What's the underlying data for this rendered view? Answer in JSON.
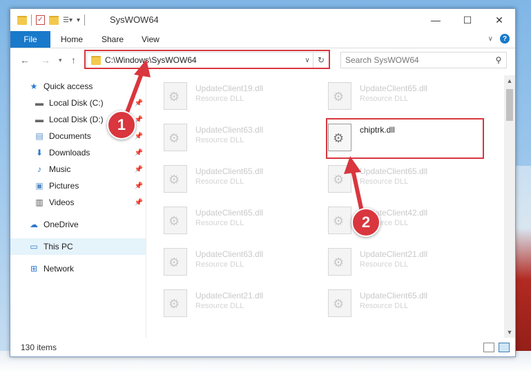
{
  "window": {
    "title": "SysWOW64",
    "qa_overflow": "▾"
  },
  "ribbon": {
    "file": "File",
    "home": "Home",
    "share": "Share",
    "view": "View"
  },
  "address": {
    "path": "C:\\Windows\\SysWOW64",
    "search_placeholder": "Search SysWOW64"
  },
  "sidebar": {
    "items": [
      {
        "label": "Quick access",
        "icon": "star-icon",
        "pinned": false
      },
      {
        "label": "Local Disk (C:)",
        "icon": "drive-icon",
        "pinned": true
      },
      {
        "label": "Local Disk (D:)",
        "icon": "drive-icon",
        "pinned": true
      },
      {
        "label": "Documents",
        "icon": "documents-icon",
        "pinned": true
      },
      {
        "label": "Downloads",
        "icon": "download-icon",
        "pinned": true
      },
      {
        "label": "Music",
        "icon": "music-icon",
        "pinned": true
      },
      {
        "label": "Pictures",
        "icon": "pictures-icon",
        "pinned": true
      },
      {
        "label": "Videos",
        "icon": "videos-icon",
        "pinned": true
      },
      {
        "label": "OneDrive",
        "icon": "cloud-icon",
        "pinned": false
      },
      {
        "label": "This PC",
        "icon": "pc-icon",
        "pinned": false,
        "selected": true
      },
      {
        "label": "Network",
        "icon": "network-icon",
        "pinned": false
      }
    ]
  },
  "files": [
    {
      "name": "UpdateClient19.dll",
      "type": "Resource DLL"
    },
    {
      "name": "UpdateClient65.dll",
      "type": "Resource DLL"
    },
    {
      "name": "UpdateClient63.dll",
      "type": "Resource DLL"
    },
    {
      "name": "chiptrk.dll",
      "type": "",
      "highlighted": true
    },
    {
      "name": "UpdateClient65.dll",
      "type": "Resource DLL"
    },
    {
      "name": "UpdateClient65.dll",
      "type": "Resource DLL"
    },
    {
      "name": "UpdateClient65.dll",
      "type": "Resource DLL"
    },
    {
      "name": "UpdateClient42.dll",
      "type": "Resource DLL"
    },
    {
      "name": "UpdateClient63.dll",
      "type": "Resource DLL"
    },
    {
      "name": "UpdateClient21.dll",
      "type": "Resource DLL"
    },
    {
      "name": "UpdateClient21.dll",
      "type": "Resource DLL"
    },
    {
      "name": "UpdateClient65.dll",
      "type": "Resource DLL"
    }
  ],
  "status": {
    "items_count": "130 items"
  },
  "annotations": {
    "badge1": "1",
    "badge2": "2",
    "color": "#d9363e"
  }
}
